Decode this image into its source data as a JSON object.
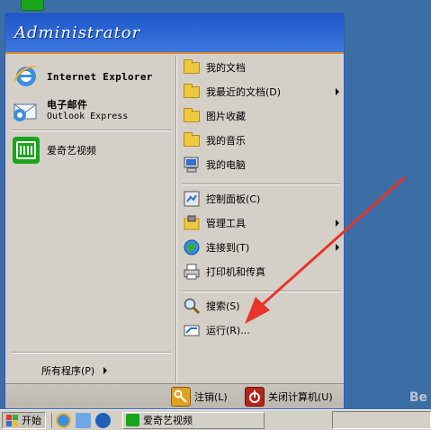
{
  "start_menu": {
    "user_name": "Administrator",
    "pinned": [
      {
        "title": "Internet Explorer",
        "subtitle": ""
      },
      {
        "title": "电子邮件",
        "subtitle": "Outlook Express"
      }
    ],
    "recent": [
      {
        "title": "爱奇艺视频"
      }
    ],
    "all_programs_label": "所有程序(P)",
    "right": [
      {
        "label": "我的文档",
        "icon": "my-documents-icon"
      },
      {
        "label": "我最近的文档(D)",
        "icon": "recent-documents-icon",
        "submenu": true
      },
      {
        "label": "图片收藏",
        "icon": "my-pictures-icon"
      },
      {
        "label": "我的音乐",
        "icon": "my-music-icon"
      },
      {
        "label": "我的电脑",
        "icon": "my-computer-icon"
      },
      {
        "label": "控制面板(C)",
        "icon": "control-panel-icon"
      },
      {
        "label": "管理工具",
        "icon": "admin-tools-icon",
        "submenu": true
      },
      {
        "label": "连接到(T)",
        "icon": "connect-to-icon",
        "submenu": true
      },
      {
        "label": "打印机和传真",
        "icon": "printers-icon"
      },
      {
        "label": "搜索(S)",
        "icon": "search-icon"
      },
      {
        "label": "运行(R)...",
        "icon": "run-icon"
      }
    ],
    "footer": {
      "logoff_label": "注销(L)",
      "shutdown_label": "关闭计算机(U)"
    }
  },
  "taskbar": {
    "start_label": "开始",
    "task_label": "爱奇艺视频"
  },
  "watermark": "Be"
}
